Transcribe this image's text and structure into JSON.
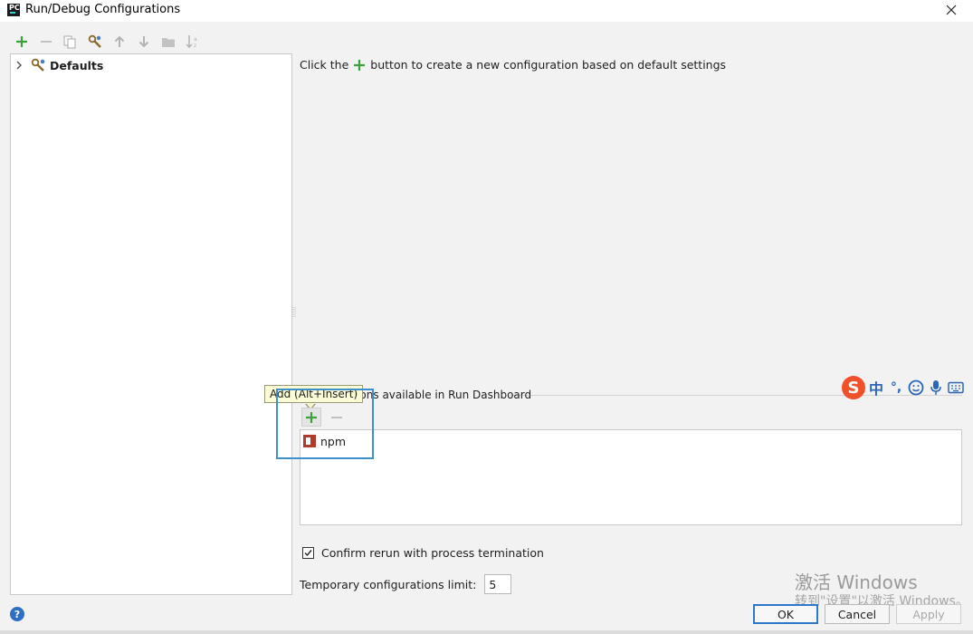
{
  "window": {
    "title": "Run/Debug Configurations",
    "icons": {
      "app": "pycharm-icon",
      "close": "close-icon"
    }
  },
  "toolbar": {
    "items": [
      {
        "name": "add",
        "icon": "plus-icon",
        "enabled": true,
        "color": "#3ca33c"
      },
      {
        "name": "remove",
        "icon": "minus-icon",
        "enabled": false
      },
      {
        "name": "copy",
        "icon": "copy-icon",
        "enabled": false
      },
      {
        "name": "edit-defaults",
        "icon": "wrench-icon",
        "enabled": true
      },
      {
        "name": "move-up",
        "icon": "arrow-up-icon",
        "enabled": false
      },
      {
        "name": "move-down",
        "icon": "arrow-down-icon",
        "enabled": false
      },
      {
        "name": "folder",
        "icon": "folder-icon",
        "enabled": false
      },
      {
        "name": "sort",
        "icon": "sort-alpha-icon",
        "enabled": false
      }
    ]
  },
  "tree": {
    "items": [
      {
        "label": "Defaults",
        "expanded": false,
        "icon": "defaults-wrench-icon"
      }
    ]
  },
  "hint": {
    "before": "Click the",
    "after": "button to create a new configuration based on default settings"
  },
  "dashboard": {
    "group_label": "Configurations available in Run Dashboard",
    "tooltip": "Add (Alt+Insert)",
    "items": [
      {
        "label": "npm",
        "icon": "npm-icon"
      }
    ]
  },
  "options": {
    "confirm_rerun": {
      "label": "Confirm rerun with process termination",
      "checked": true
    },
    "temp_limit": {
      "label": "Temporary configurations limit:",
      "value": "5"
    }
  },
  "buttons": {
    "ok": "OK",
    "cancel": "Cancel",
    "apply": "Apply",
    "help": "?"
  },
  "watermark": {
    "line1": "激活 Windows",
    "line2": "转到\"设置\"以激活 Windows。"
  },
  "ime": {
    "logo": "S",
    "lang": "中",
    "punct": "°,",
    "icons": [
      "smiley-icon",
      "microphone-icon",
      "keyboard-icon"
    ]
  },
  "colors": {
    "accent": "#2f78c9",
    "plus_green": "#3ca33c",
    "highlight_box": "#3d8fce",
    "npm_red": "#b23a2a"
  }
}
